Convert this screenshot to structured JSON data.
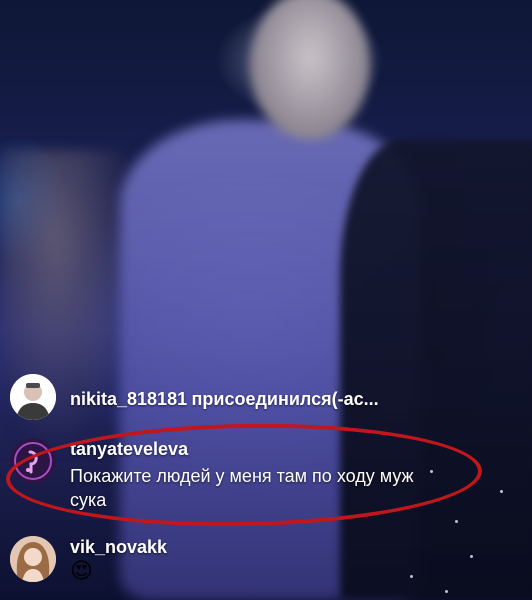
{
  "stream": {
    "background": "live-concert-video"
  },
  "comments": [
    {
      "username": "nikita_818181",
      "text": "присоединился(-ас...",
      "avatar": "avatar-man"
    },
    {
      "username": "tanyateveleva",
      "text": "Покажите людей у меня там по ходу муж сука",
      "avatar": "avatar-purple"
    },
    {
      "username": "vik_novakk",
      "text": "😍",
      "avatar": "avatar-woman"
    }
  ],
  "annotation": {
    "color": "#c0161c",
    "target": "comment-2"
  }
}
